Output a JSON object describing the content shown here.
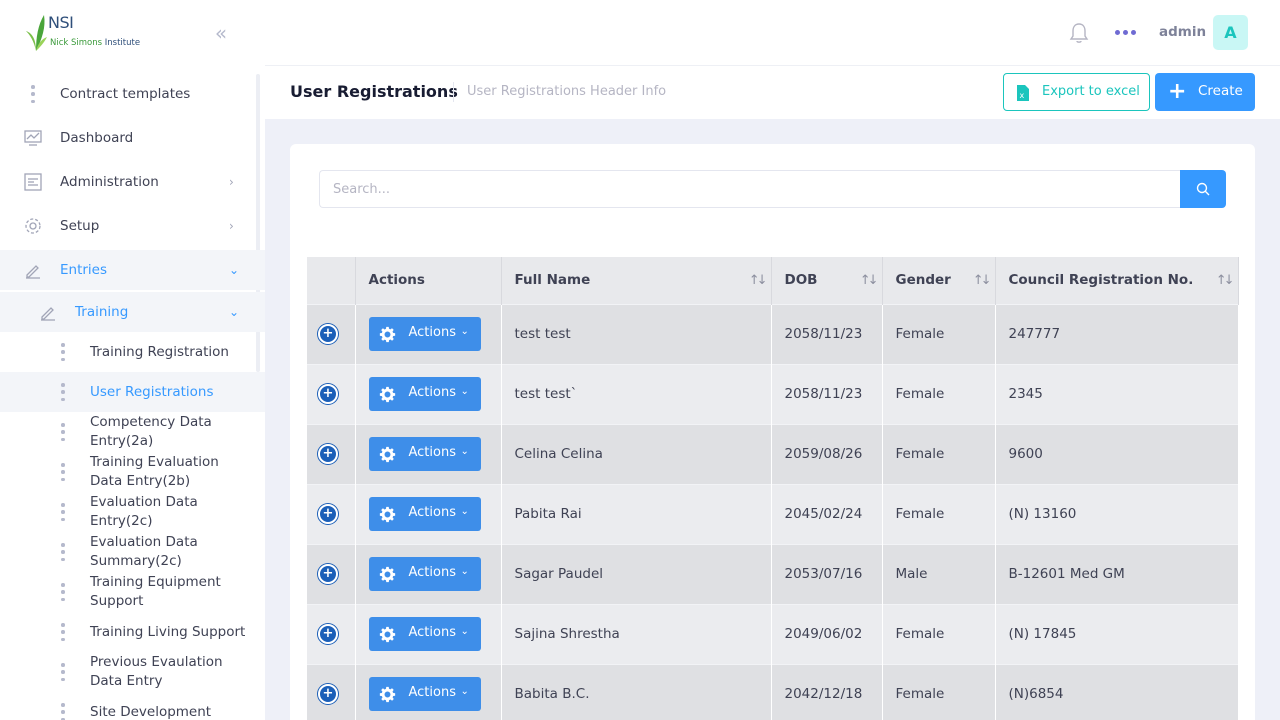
{
  "brand": {
    "logo_text": "NSI",
    "logo_sub_1": "Nick Simons",
    "logo_sub_2": "Institute"
  },
  "sidebar": {
    "items": [
      {
        "label": "Contract templates",
        "icon": "dots-vertical-icon"
      },
      {
        "label": "Dashboard",
        "icon": "chart-icon"
      },
      {
        "label": "Administration",
        "icon": "admin-icon"
      },
      {
        "label": "Setup",
        "icon": "gear-icon"
      },
      {
        "label": "Entries",
        "icon": "pencil-icon"
      }
    ],
    "training": {
      "label": "Training",
      "icon": "pencil-icon"
    },
    "sub_items": [
      {
        "label": "Training Registration"
      },
      {
        "label": "User Registrations"
      },
      {
        "label": "Competency Data Entry(2a)"
      },
      {
        "label": "Training Evaluation Data Entry(2b)"
      },
      {
        "label": "Evaluation Data Entry(2c)"
      },
      {
        "label": "Evaluation Data Summary(2c)"
      },
      {
        "label": "Training Equipment Support"
      },
      {
        "label": "Training Living Support"
      },
      {
        "label": "Previous Evaulation Data Entry"
      },
      {
        "label": "Site Development"
      }
    ]
  },
  "topbar": {
    "username": "admin",
    "avatar_letter": "A"
  },
  "subheader": {
    "title": "User Registrations",
    "subtitle": "User Registrations Header Info",
    "export_label": "Export to excel",
    "create_label": "Create"
  },
  "search": {
    "placeholder": "Search..."
  },
  "table": {
    "columns": [
      "",
      "Actions",
      "Full Name",
      "DOB",
      "Gender",
      "Council Registration No."
    ],
    "action_label": "Actions",
    "rows": [
      {
        "name": "test test",
        "dob": "2058/11/23",
        "gender": "Female",
        "reg": "247777"
      },
      {
        "name": "test test`",
        "dob": "2058/11/23",
        "gender": "Female",
        "reg": "2345"
      },
      {
        "name": "Celina Celina",
        "dob": "2059/08/26",
        "gender": "Female",
        "reg": "9600"
      },
      {
        "name": "Pabita Rai",
        "dob": "2045/02/24",
        "gender": "Female",
        "reg": "(N) 13160"
      },
      {
        "name": "Sagar Paudel",
        "dob": "2053/07/16",
        "gender": "Male",
        "reg": "B-12601 Med GM"
      },
      {
        "name": "Sajina Shrestha",
        "dob": "2049/06/02",
        "gender": "Female",
        "reg": "(N) 17845"
      },
      {
        "name": "Babita B.C.",
        "dob": "2042/12/18",
        "gender": "Female",
        "reg": "(N)6854"
      }
    ]
  },
  "colors": {
    "primary": "#3699ff",
    "success": "#1bc5bd",
    "actions_button": "#3e8ee9"
  }
}
